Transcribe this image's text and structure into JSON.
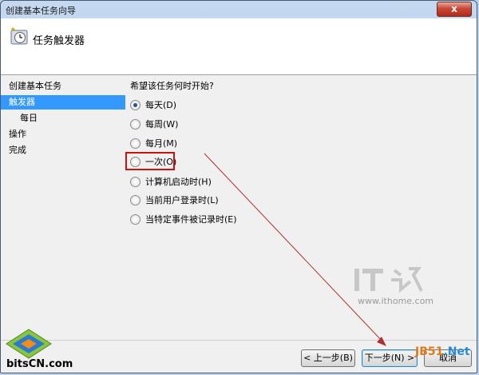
{
  "window": {
    "title": "创建基本任务向导",
    "close_symbol": "x"
  },
  "header": {
    "title": "任务触发器",
    "icon": "task-scheduler-clock-icon"
  },
  "steps": [
    {
      "label": "创建基本任务",
      "active": false,
      "indent": false
    },
    {
      "label": "触发器",
      "active": true,
      "indent": false
    },
    {
      "label": "每日",
      "active": false,
      "indent": true
    },
    {
      "label": "操作",
      "active": false,
      "indent": false
    },
    {
      "label": "完成",
      "active": false,
      "indent": false
    }
  ],
  "content": {
    "prompt": "希望该任务何时开始?",
    "options": [
      {
        "label": "每天(D)",
        "checked": true
      },
      {
        "label": "每周(W)",
        "checked": false
      },
      {
        "label": "每月(M)",
        "checked": false
      },
      {
        "label": "一次(O)",
        "checked": false
      },
      {
        "label": "计算机启动时(H)",
        "checked": false
      },
      {
        "label": "当前用户登录时(L)",
        "checked": false
      },
      {
        "label": "当特定事件被记录时(E)",
        "checked": false
      }
    ]
  },
  "buttons": {
    "back": "< 上一步(B)",
    "next": "下一步(N) >",
    "cancel": "取消"
  },
  "watermarks": {
    "it_logo": "IT之家",
    "site": "www.ithome.com",
    "jb51": "JB51",
    "jb51_net": ".Net",
    "bitscn": "bitsCN.com"
  },
  "colors": {
    "selection": "#3399ff",
    "highlight_box": "#cc1111",
    "arrow": "#b03030"
  }
}
